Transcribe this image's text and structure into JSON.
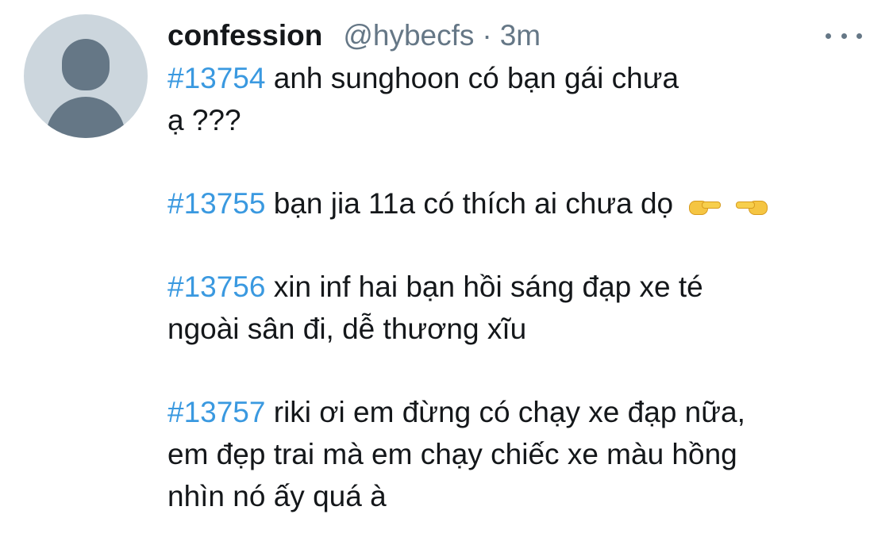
{
  "tweet": {
    "display_name": "confession",
    "handle": "@hybecfs",
    "separator": "·",
    "time": "3m",
    "posts": [
      {
        "tag": "#13754",
        "lines": [
          "anh sunghoon có bạn gái chưa",
          "ạ ???"
        ]
      },
      {
        "tag": "#13755",
        "lines": [
          "bạn jia 11a có thích ai chưa dọ"
        ],
        "emojis": [
          "pointing-right-icon",
          "pointing-left-icon"
        ]
      },
      {
        "tag": "#13756",
        "lines": [
          "xin inf hai bạn hồi sáng đạp xe té",
          "ngoài sân đi, dễ thương xĩu"
        ]
      },
      {
        "tag": "#13757",
        "lines": [
          "riki ơi em đừng có chạy xe đạp nữa,",
          "em đẹp trai mà em chạy chiếc xe màu hồng",
          "nhìn nó ấy quá à"
        ]
      }
    ]
  },
  "icons": {
    "more": "more-horizontal-icon",
    "avatar": "default-avatar-icon"
  },
  "colors": {
    "hashtag": "#3a99e0",
    "secondary_text": "#657786",
    "avatar_bg": "#ccd6dd"
  }
}
